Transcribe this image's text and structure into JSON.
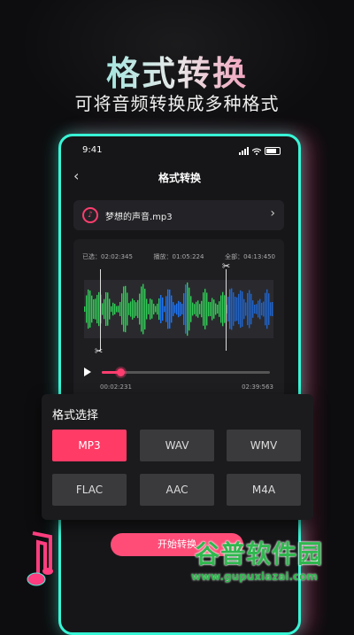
{
  "hero": {
    "title": "格式转换",
    "subtitle": "可将音频转换成多种格式"
  },
  "status_bar": {
    "time": "9:41"
  },
  "nav": {
    "title": "格式转换",
    "back_icon": "chevron-left-icon"
  },
  "file": {
    "name": "梦想的声音.mp3",
    "icon": "music-disc-icon",
    "chevron": "chevron-right-icon"
  },
  "waveform": {
    "selected": "已选：02:02:345",
    "playing": "播放：01:05:224",
    "total": "全部：04:13:450",
    "progress": 0.11,
    "time_current": "00:02:231",
    "time_total": "02:39:563",
    "colors": {
      "green": "#33d45a",
      "blue": "#1e78ff",
      "accent": "#ff3d6f"
    }
  },
  "format_sheet": {
    "title": "格式选择",
    "options": [
      "MP3",
      "WAV",
      "WMV",
      "FLAC",
      "AAC",
      "M4A"
    ],
    "selected": "MP3"
  },
  "start_button": {
    "label": "开始转换"
  },
  "watermark": {
    "title": "谷普软件园",
    "url": "www.gupuxiazai.com"
  }
}
